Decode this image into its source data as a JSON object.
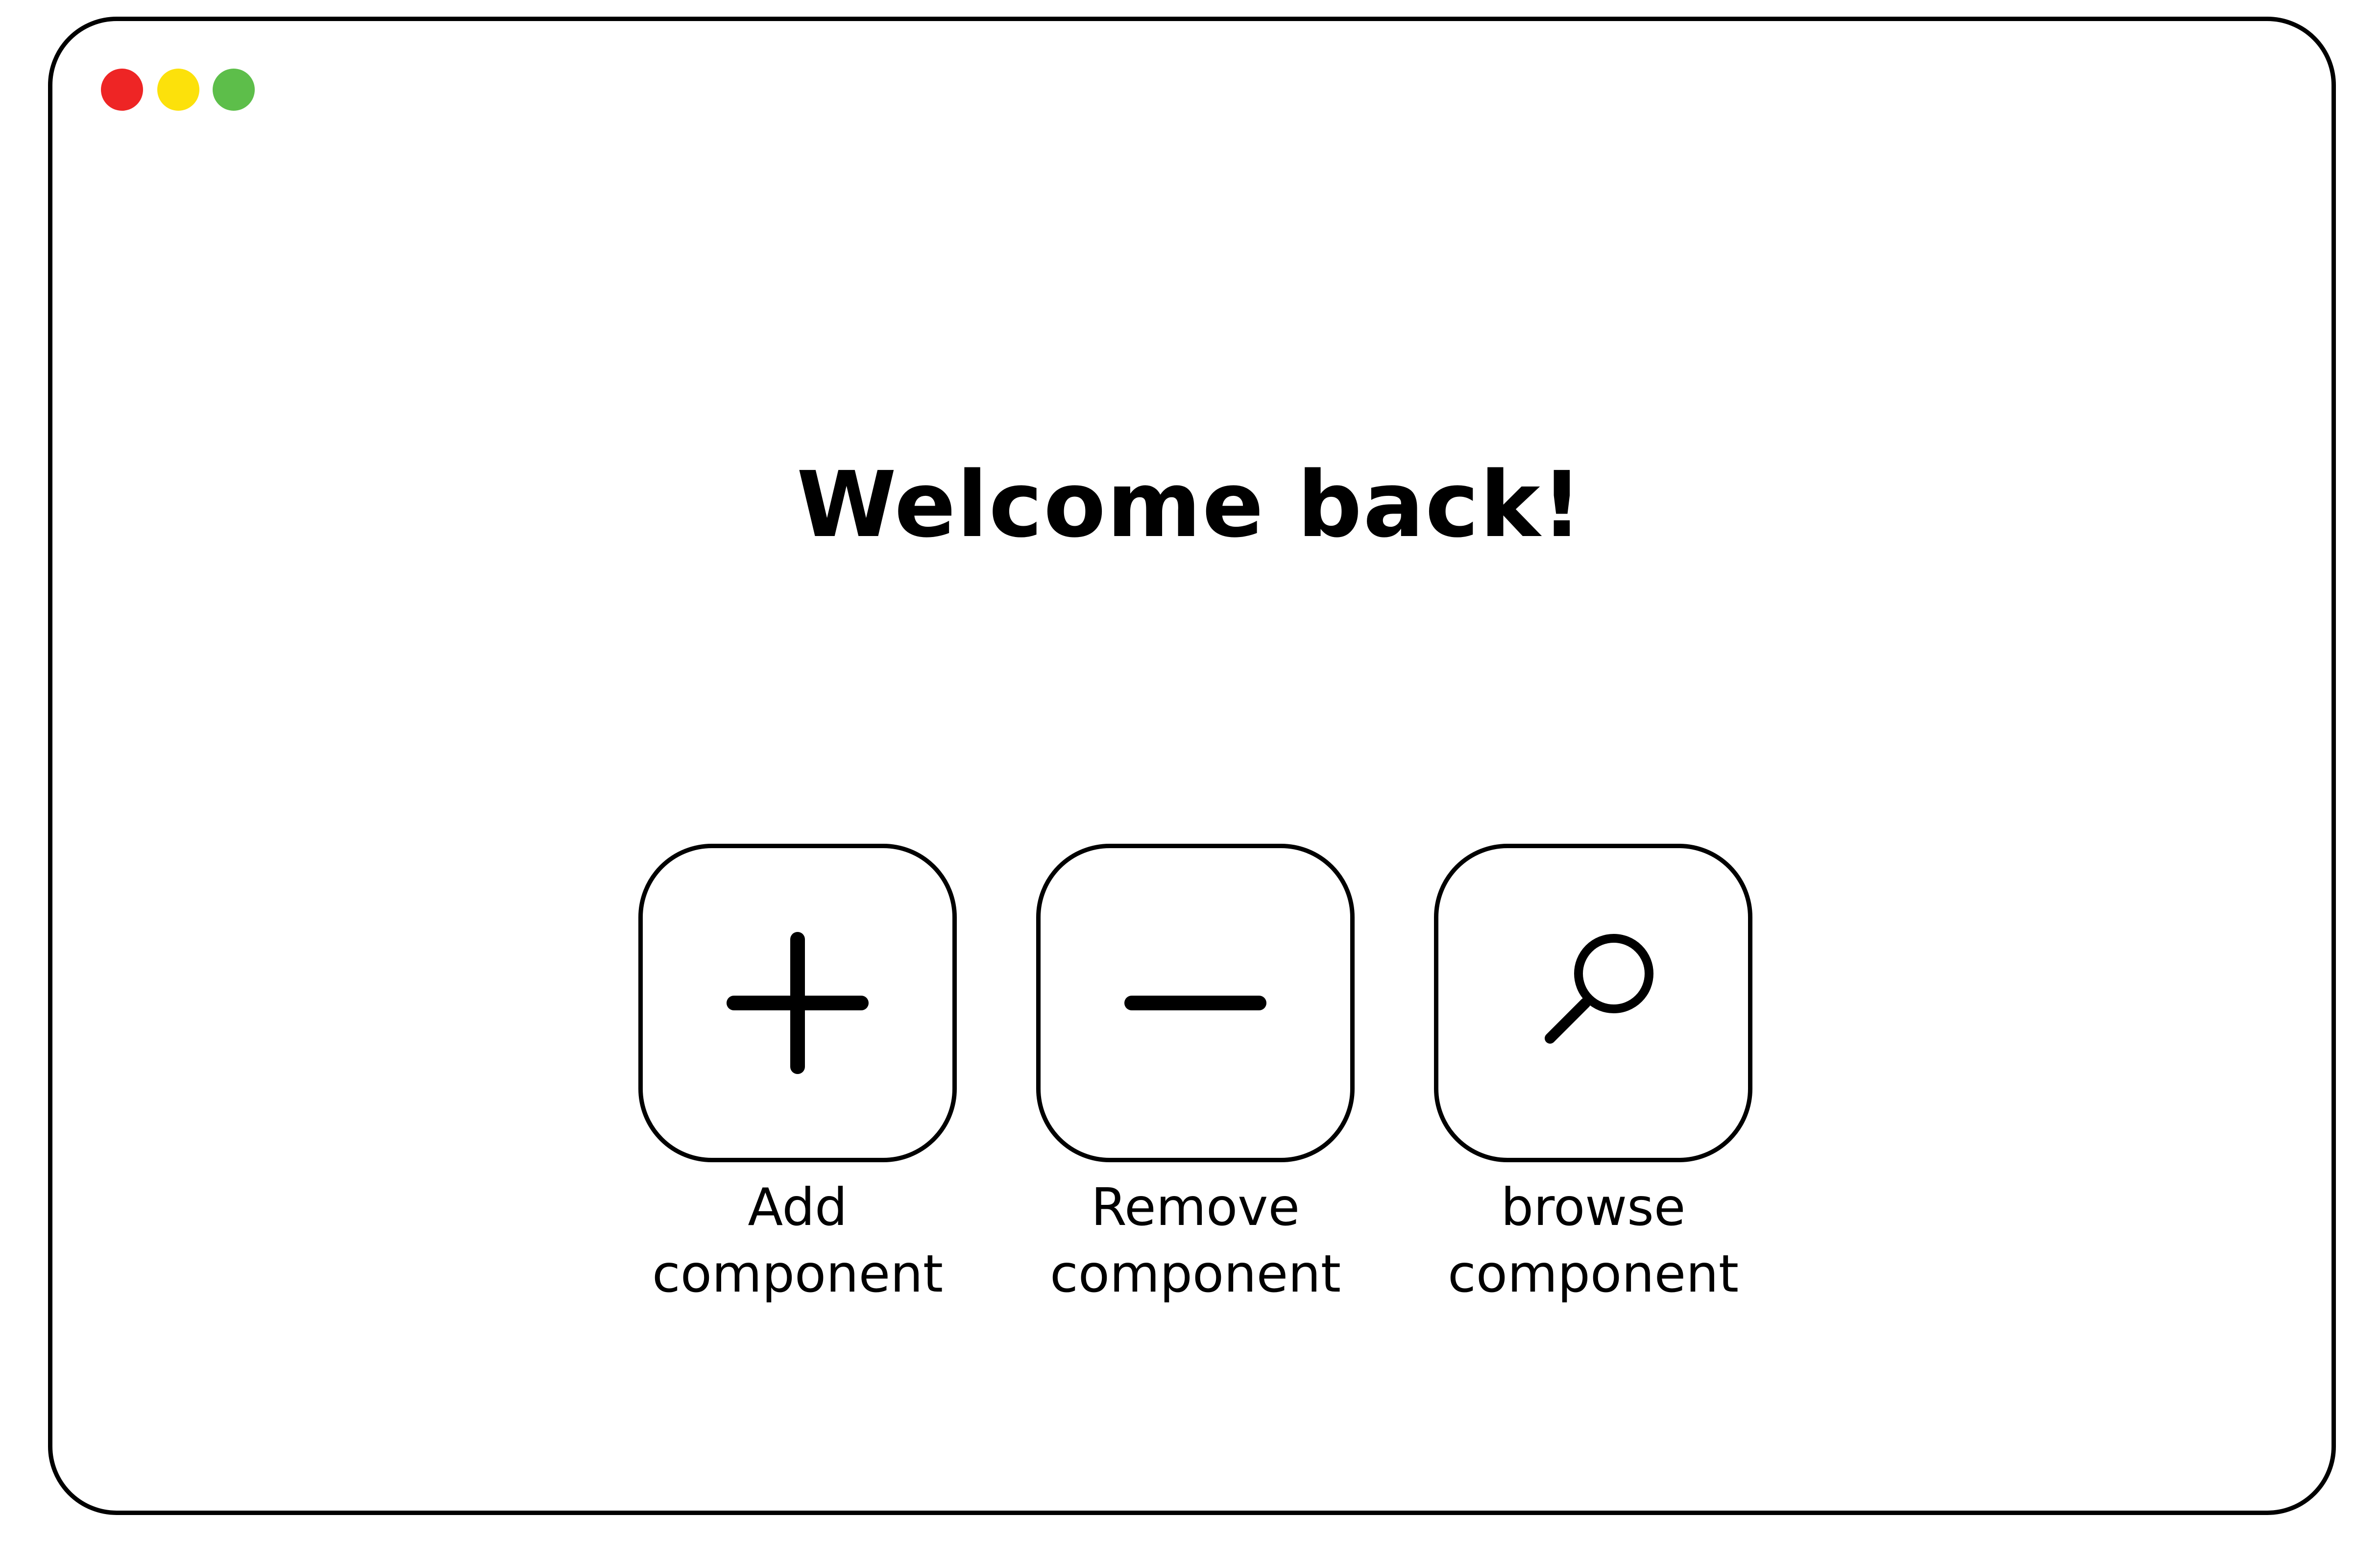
{
  "window": {
    "controls": [
      {
        "name": "close",
        "color": "#EE2525"
      },
      {
        "name": "minimize",
        "color": "#FCE10B"
      },
      {
        "name": "zoom",
        "color": "#5DBE4A"
      }
    ]
  },
  "main": {
    "title": "Welcome back!",
    "actions": [
      {
        "icon": "plus-icon",
        "label_line1": "Add",
        "label_line2": "component"
      },
      {
        "icon": "minus-icon",
        "label_line1": "Remove",
        "label_line2": "component"
      },
      {
        "icon": "search-icon",
        "label_line1": "browse",
        "label_line2": "component"
      }
    ]
  }
}
